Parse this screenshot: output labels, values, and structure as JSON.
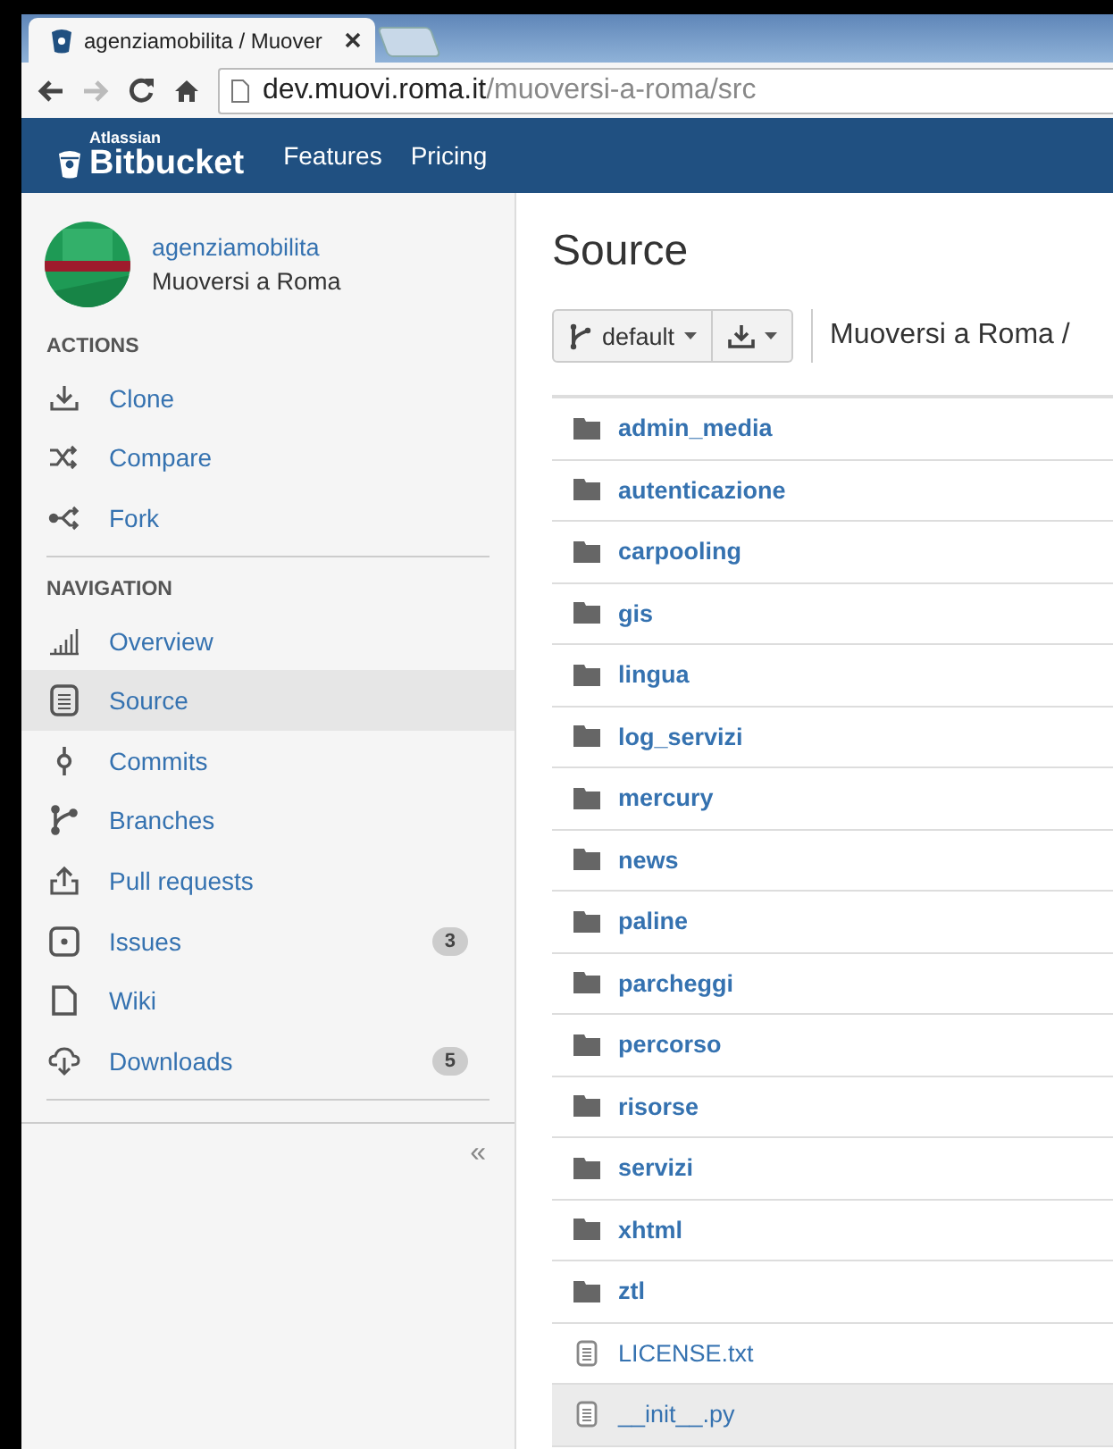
{
  "browser": {
    "tab_title": "agenziamobilita / Muover",
    "url_host": "dev.muovi.roma.it",
    "url_path": "/muoversi-a-roma/src"
  },
  "header": {
    "brand_top": "Atlassian",
    "brand": "Bitbucket",
    "links": [
      "Features",
      "Pricing"
    ]
  },
  "repo": {
    "owner": "agenziamobilita",
    "name": "Muoversi a Roma"
  },
  "actions": {
    "heading": "ACTIONS",
    "items": [
      {
        "label": "Clone"
      },
      {
        "label": "Compare"
      },
      {
        "label": "Fork"
      }
    ]
  },
  "navigation": {
    "heading": "NAVIGATION",
    "items": [
      {
        "label": "Overview",
        "selected": false
      },
      {
        "label": "Source",
        "selected": true
      },
      {
        "label": "Commits",
        "selected": false
      },
      {
        "label": "Branches",
        "selected": false
      },
      {
        "label": "Pull requests",
        "selected": false
      },
      {
        "label": "Issues",
        "selected": false,
        "count": "3"
      },
      {
        "label": "Wiki",
        "selected": false
      },
      {
        "label": "Downloads",
        "selected": false,
        "count": "5"
      }
    ]
  },
  "collapse": "«",
  "page_title": "Source",
  "branch": "default",
  "breadcrumb": "Muoversi a Roma /",
  "files": [
    {
      "name": "admin_media",
      "kind": "folder",
      "highlighted": false
    },
    {
      "name": "autenticazione",
      "kind": "folder",
      "highlighted": false
    },
    {
      "name": "carpooling",
      "kind": "folder",
      "highlighted": false
    },
    {
      "name": "gis",
      "kind": "folder",
      "highlighted": false
    },
    {
      "name": "lingua",
      "kind": "folder",
      "highlighted": false
    },
    {
      "name": "log_servizi",
      "kind": "folder",
      "highlighted": false
    },
    {
      "name": "mercury",
      "kind": "folder",
      "highlighted": false
    },
    {
      "name": "news",
      "kind": "folder",
      "highlighted": false
    },
    {
      "name": "paline",
      "kind": "folder",
      "highlighted": false
    },
    {
      "name": "parcheggi",
      "kind": "folder",
      "highlighted": false
    },
    {
      "name": "percorso",
      "kind": "folder",
      "highlighted": false
    },
    {
      "name": "risorse",
      "kind": "folder",
      "highlighted": false
    },
    {
      "name": "servizi",
      "kind": "folder",
      "highlighted": false
    },
    {
      "name": "xhtml",
      "kind": "folder",
      "highlighted": false
    },
    {
      "name": "ztl",
      "kind": "folder",
      "highlighted": false
    },
    {
      "name": "LICENSE.txt",
      "kind": "file",
      "highlighted": false
    },
    {
      "name": "__init__.py",
      "kind": "file",
      "highlighted": true
    }
  ]
}
